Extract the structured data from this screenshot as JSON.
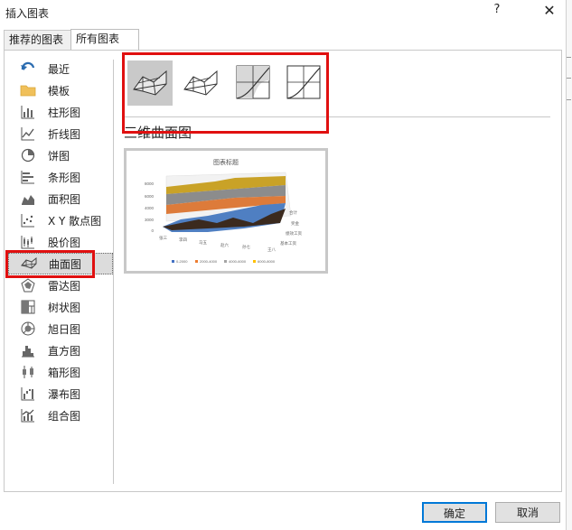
{
  "window": {
    "title": "插入图表",
    "help_glyph": "?",
    "close_glyph": "✕"
  },
  "tabs": [
    {
      "label": "推荐的图表",
      "active": false
    },
    {
      "label": "所有图表",
      "active": true
    }
  ],
  "categories": [
    {
      "label": "最近",
      "icon": "undo-arrow-icon"
    },
    {
      "label": "模板",
      "icon": "folder-icon"
    },
    {
      "label": "柱形图",
      "icon": "column-chart-icon"
    },
    {
      "label": "折线图",
      "icon": "line-chart-icon"
    },
    {
      "label": "饼图",
      "icon": "pie-chart-icon"
    },
    {
      "label": "条形图",
      "icon": "bar-chart-icon"
    },
    {
      "label": "面积图",
      "icon": "area-chart-icon"
    },
    {
      "label": "X Y 散点图",
      "icon": "scatter-chart-icon"
    },
    {
      "label": "股价图",
      "icon": "stock-chart-icon"
    },
    {
      "label": "曲面图",
      "icon": "surface-chart-icon",
      "selected": true
    },
    {
      "label": "雷达图",
      "icon": "radar-chart-icon"
    },
    {
      "label": "树状图",
      "icon": "treemap-chart-icon"
    },
    {
      "label": "旭日图",
      "icon": "sunburst-chart-icon"
    },
    {
      "label": "直方图",
      "icon": "histogram-chart-icon"
    },
    {
      "label": "箱形图",
      "icon": "box-whisker-chart-icon"
    },
    {
      "label": "瀑布图",
      "icon": "waterfall-chart-icon"
    },
    {
      "label": "组合图",
      "icon": "combo-chart-icon"
    }
  ],
  "subtypes": [
    {
      "icon": "3d-surface-icon",
      "selected": true
    },
    {
      "icon": "wireframe-3d-surface-icon",
      "selected": false
    },
    {
      "icon": "contour-icon",
      "selected": false
    },
    {
      "icon": "wireframe-contour-icon",
      "selected": false
    }
  ],
  "section_title": "三维曲面图",
  "preview": {
    "chart_title": "图表标题",
    "y_ticks": [
      "8000",
      "6000",
      "4000",
      "3000",
      "0"
    ],
    "x_labels": [
      "张三",
      "李四",
      "马五",
      "赵六",
      "孙七",
      "王八"
    ],
    "depth_labels": [
      "合计",
      "奖金",
      "绩效工资",
      "基本工资"
    ],
    "legend": [
      {
        "label": "0-2000",
        "color": "#4472c4"
      },
      {
        "label": "2000-4000",
        "color": "#ed7d31"
      },
      {
        "label": "4000-6000",
        "color": "#a5a5a5"
      },
      {
        "label": "6000-8000",
        "color": "#ffc000"
      }
    ]
  },
  "buttons": {
    "ok": "确定",
    "cancel": "取消"
  },
  "colors": {
    "highlight": "#e01010",
    "ok_border": "#0078d7"
  }
}
